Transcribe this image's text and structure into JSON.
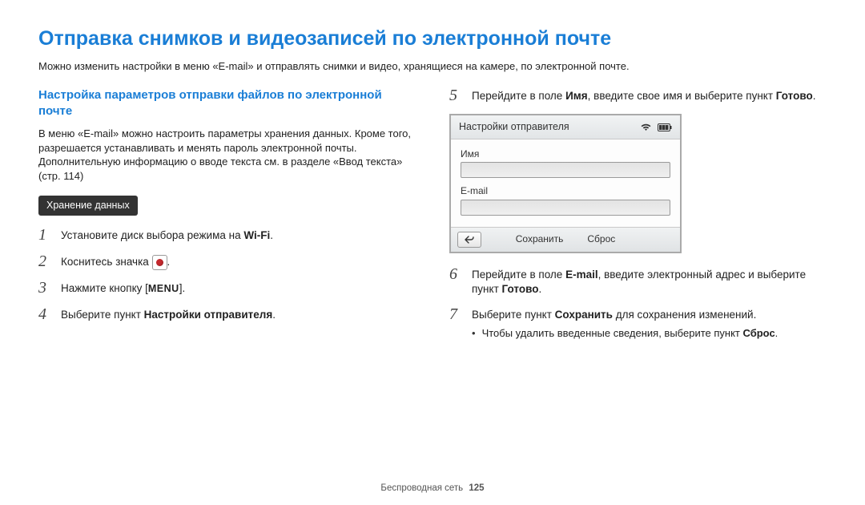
{
  "title": "Отправка снимков и видеозаписей по электронной почте",
  "intro": "Можно изменить настройки в меню «E-mail» и отправлять снимки и видео, хранящиеся на камере, по электронной почте.",
  "left": {
    "subhead": "Настройка параметров отправки файлов по электронной почте",
    "para": "В меню «E-mail» можно настроить параметры хранения данных. Кроме того, разрешается устанавливать и менять пароль электронной почты. Дополнительную информацию о вводе текста см. в разделе «Ввод текста» (стр. 114)",
    "badge": "Хранение данных",
    "steps": {
      "s1_a": "Установите диск выбора режима на ",
      "wifi": "Wi-Fi",
      "s1_b": ".",
      "s2_a": "Коснитесь значка ",
      "s2_b": ".",
      "s3_a": "Нажмите кнопку [",
      "menu": "MENU",
      "s3_b": "].",
      "s4_a": "Выберите пункт ",
      "s4_bold": "Настройки отправителя",
      "s4_b": "."
    }
  },
  "right": {
    "steps": {
      "s5_a": "Перейдите в поле ",
      "s5_bold1": "Имя",
      "s5_b": ", введите свое имя и выберите пункт ",
      "s5_bold2": "Готово",
      "s5_c": ".",
      "s6_a": "Перейдите в поле ",
      "s6_bold1": "E-mail",
      "s6_b": ", введите электронный адрес и выберите пункт ",
      "s6_bold2": "Готово",
      "s6_c": ".",
      "s7_a": "Выберите пункт ",
      "s7_bold": "Сохранить",
      "s7_b": " для сохранения изменений.",
      "bullet_a": "Чтобы удалить введенные сведения, выберите пункт ",
      "bullet_bold": "Сброс",
      "bullet_b": "."
    }
  },
  "device": {
    "title": "Настройки отправителя",
    "label_name": "Имя",
    "label_email": "E-mail",
    "btn_save": "Сохранить",
    "btn_reset": "Сброс"
  },
  "footer": {
    "section": "Беспроводная сеть",
    "page": "125"
  }
}
